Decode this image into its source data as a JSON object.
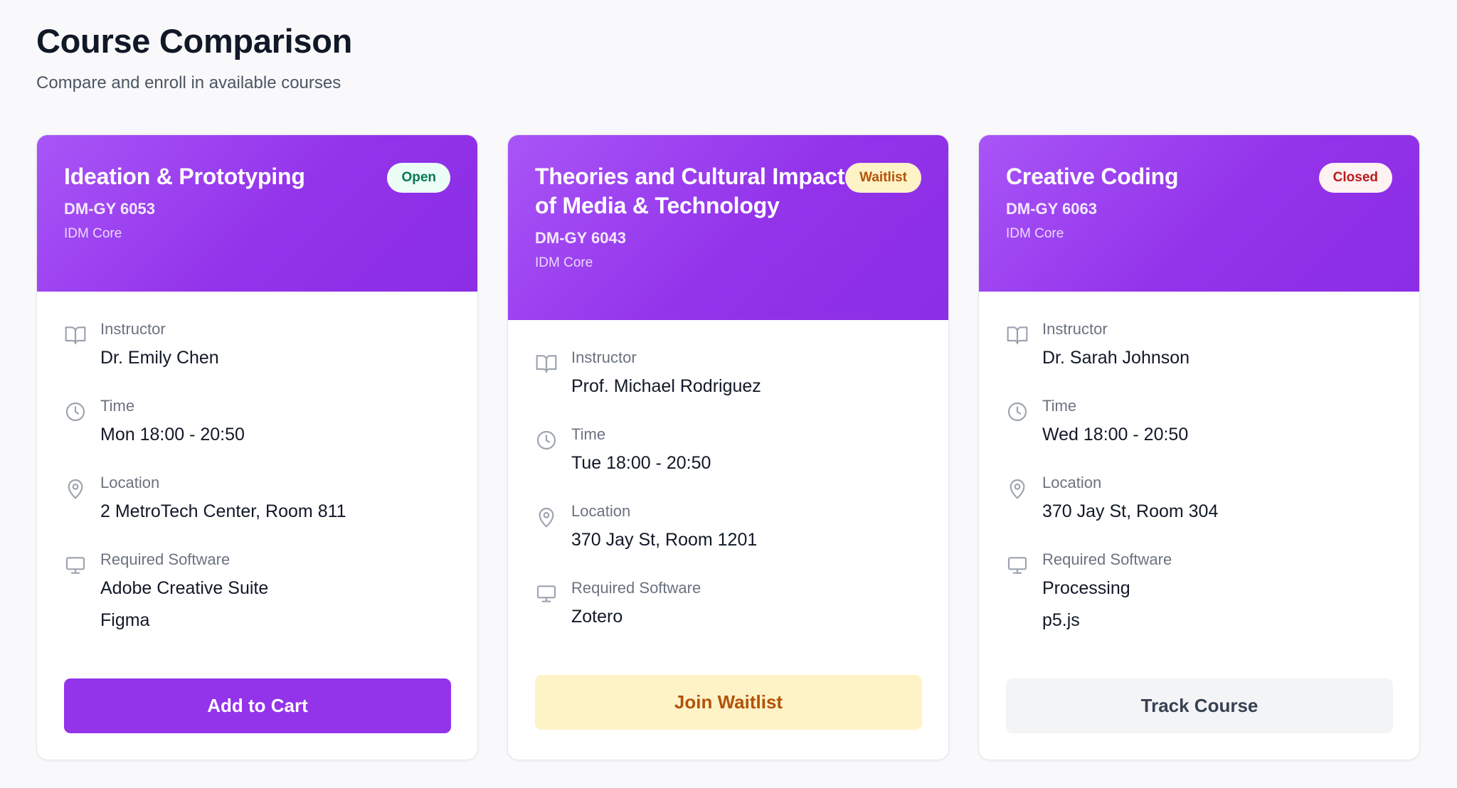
{
  "page": {
    "title": "Course Comparison",
    "subtitle": "Compare and enroll in available courses"
  },
  "labels": {
    "instructor": "Instructor",
    "time": "Time",
    "location": "Location",
    "software": "Required Software"
  },
  "courses": [
    {
      "title": "Ideation & Prototyping",
      "code": "DM-GY 6053",
      "program": "IDM Core",
      "status": "Open",
      "instructor": "Dr. Emily Chen",
      "time": "Mon 18:00 - 20:50",
      "location": "2 MetroTech Center, Room 811",
      "software": [
        "Adobe Creative Suite",
        "Figma"
      ],
      "action": "Add to Cart"
    },
    {
      "title": "Theories and Cultural Impact of Media & Technology",
      "code": "DM-GY 6043",
      "program": "IDM Core",
      "status": "Waitlist",
      "instructor": "Prof. Michael Rodriguez",
      "time": "Tue 18:00 - 20:50",
      "location": "370 Jay St, Room 1201",
      "software": [
        "Zotero"
      ],
      "action": "Join Waitlist"
    },
    {
      "title": "Creative Coding",
      "code": "DM-GY 6063",
      "program": "IDM Core",
      "status": "Closed",
      "instructor": "Dr. Sarah Johnson",
      "time": "Wed 18:00 - 20:50",
      "location": "370 Jay St, Room 304",
      "software": [
        "Processing",
        "p5.js"
      ],
      "action": "Track Course"
    }
  ],
  "icons": {
    "instructor": "book-open-icon",
    "time": "clock-icon",
    "location": "map-pin-icon",
    "software": "monitor-icon"
  },
  "colors": {
    "accent": "#9333ea",
    "open": "#047857",
    "waitlist": "#b45309",
    "closed": "#b91c1c"
  }
}
